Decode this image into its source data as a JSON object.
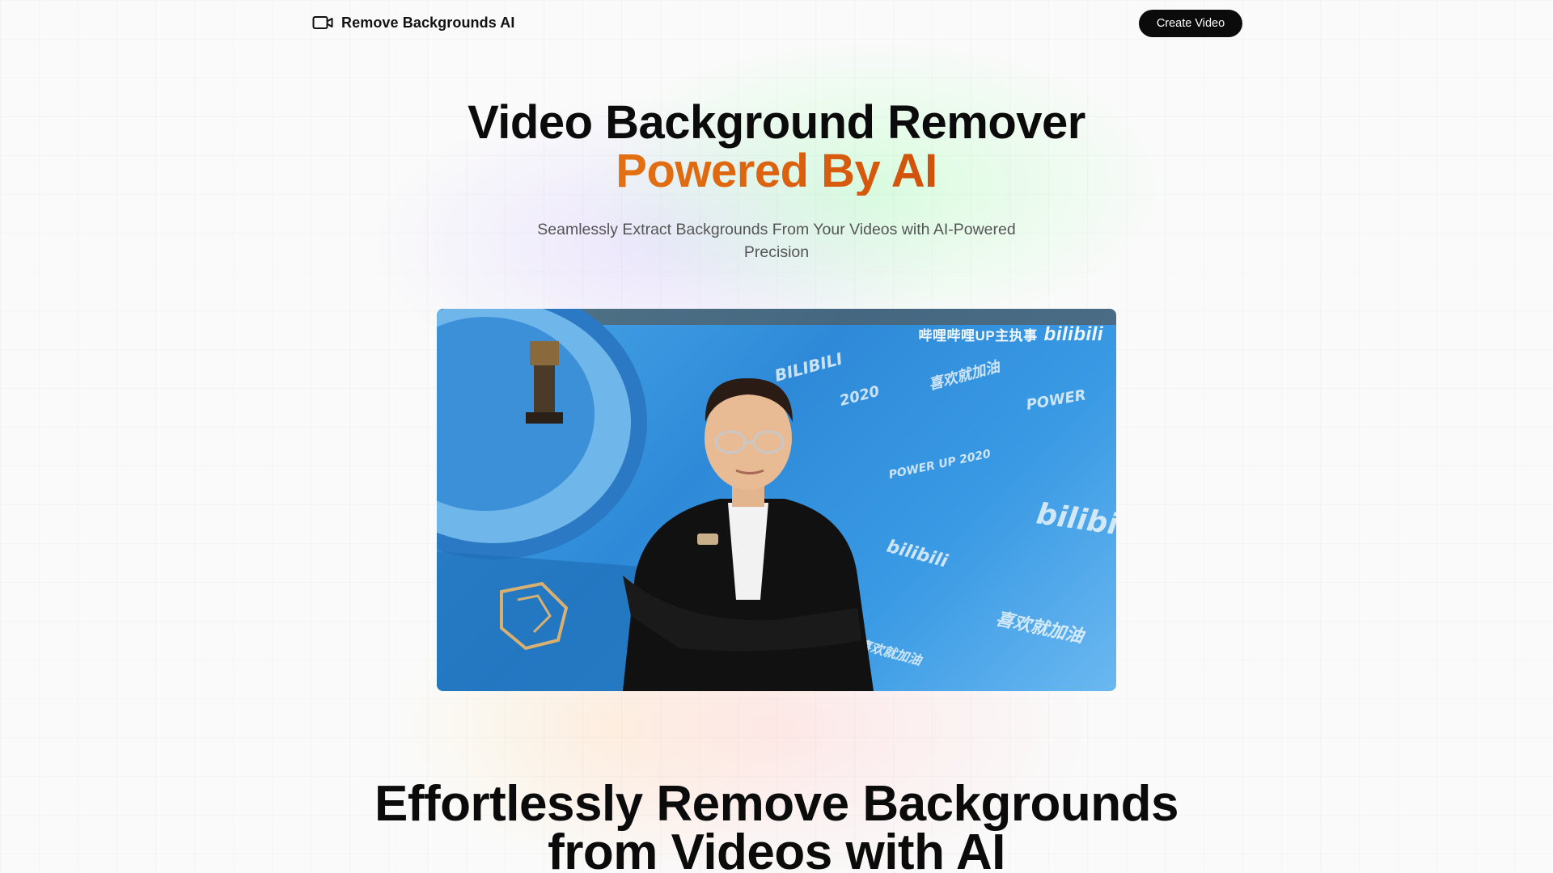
{
  "header": {
    "brand_icon": "video-camera-icon",
    "brand_label": "Remove Backgrounds AI",
    "cta_label": "Create Video"
  },
  "hero": {
    "title_line1": "Video Background Remover",
    "title_line2": "Powered By AI",
    "subtitle": "Seamlessly Extract Backgrounds From Your Videos with AI-Powered Precision"
  },
  "video": {
    "watermark_text": "哔哩哔哩UP主执事",
    "watermark_brand": "bilibili"
  },
  "section2": {
    "title_line1": "Effortlessly Remove Backgrounds",
    "title_line2": "from Videos with AI"
  },
  "colors": {
    "accent_gradient_start": "#f0a020",
    "accent_gradient_end": "#cc4a0a",
    "button_bg": "#0b0b0b",
    "video_bg": "#2e8ad8"
  }
}
